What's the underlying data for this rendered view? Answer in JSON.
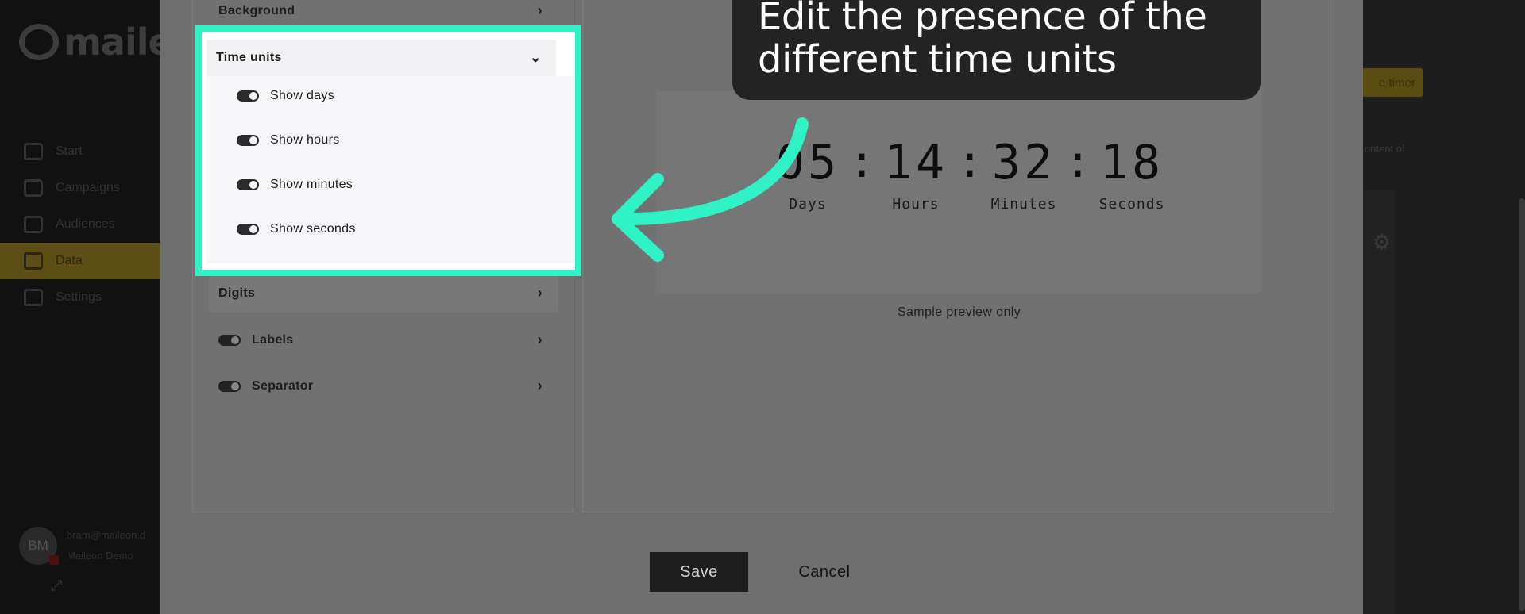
{
  "app": {
    "logo_text": "maile",
    "nav": [
      {
        "label": "Start",
        "icon": "grid-icon"
      },
      {
        "label": "Campaigns",
        "icon": "megaphone-icon"
      },
      {
        "label": "Audiences",
        "icon": "users-icon"
      },
      {
        "label": "Data",
        "icon": "folder-icon",
        "active": true
      },
      {
        "label": "Settings",
        "icon": "gear-icon"
      }
    ],
    "user": {
      "initials": "BM",
      "email": "bram@maileon.d",
      "org": "Maileon Demo"
    },
    "right": {
      "create_button": "e timer",
      "content_of": "ontent of"
    }
  },
  "editor": {
    "sections": {
      "background": "Background",
      "time_units": "Time units",
      "digits": "Digits",
      "labels": "Labels",
      "separator": "Separator"
    },
    "time_unit_toggles": [
      {
        "label": "Show days",
        "on": true
      },
      {
        "label": "Show hours",
        "on": true
      },
      {
        "label": "Show minutes",
        "on": true
      },
      {
        "label": "Show seconds",
        "on": true
      }
    ],
    "labels_enabled": true,
    "separator_enabled": true
  },
  "preview": {
    "units": [
      {
        "value": "05",
        "label": "Days"
      },
      {
        "value": "14",
        "label": "Hours"
      },
      {
        "value": "32",
        "label": "Minutes"
      },
      {
        "value": "18",
        "label": "Seconds"
      }
    ],
    "separator": ":",
    "caption": "Sample preview only"
  },
  "actions": {
    "save": "Save",
    "cancel": "Cancel"
  },
  "tooltip": {
    "line1": "Edit the presence of the",
    "line2": "different time units"
  },
  "colors": {
    "highlight": "#2ff2c6",
    "tooltip_bg": "#232323",
    "dim_overlay": "#6e6e6e",
    "brand_yellow": "#f5c518"
  }
}
